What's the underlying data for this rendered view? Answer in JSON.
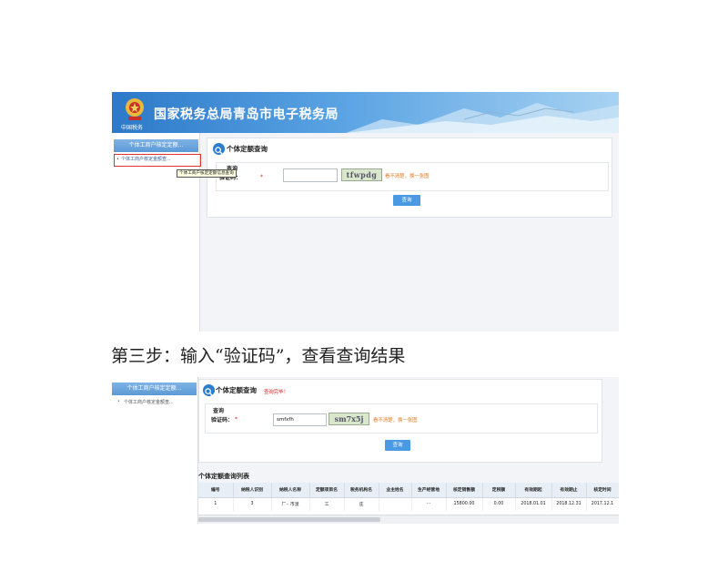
{
  "screenshot1": {
    "banner": {
      "title": "国家税务总局青岛市电子税务局",
      "emblem_caption": "中国税务"
    },
    "sidebar": {
      "header": "个体工商户核定定额...",
      "active_item": "个体工商户核定金额查..."
    },
    "tooltip": "个体工商户核定定额信息查询",
    "panel": {
      "title": "个体定额查询",
      "field_label_line1": "查询",
      "field_label_line2": "验证码：",
      "required_mark": "*",
      "captcha_value": "",
      "captcha_text": "tfwpdg",
      "refresh_link": "看不清楚，换一张图",
      "query_button": "查询"
    }
  },
  "caption": "第三步：输入“验证码”，查看查询结果",
  "screenshot2": {
    "sidebar": {
      "header": "个体工商户核定定额...",
      "item": "个体工商户核定金额查..."
    },
    "panel": {
      "title": "个体定额查询",
      "status": "查询完毕！",
      "field_label_line1": "查询",
      "field_label_line2": "验证码：",
      "required_mark": "*",
      "captcha_value": "smfxfh",
      "captcha_text": "sm7x5j",
      "refresh_link": "看不清楚，换一张图",
      "query_button": "查询"
    },
    "list": {
      "title": "个体定额查询列表",
      "columns": [
        "编号",
        "纳税人识别",
        "纳税人名称",
        "定额项目名",
        "税务机构名",
        "业主姓名",
        "生产经营地",
        "核定销售额",
        "定税额",
        "有效期起",
        "有效期止",
        "核定时间"
      ],
      "rows": [
        [
          "1",
          "3",
          "厂·· 市漠",
          "工",
          "庄",
          "",
          "···",
          "15800.00",
          "0.00",
          "2018.01.01",
          "2018.12.31",
          "2017.12.1"
        ]
      ]
    }
  }
}
